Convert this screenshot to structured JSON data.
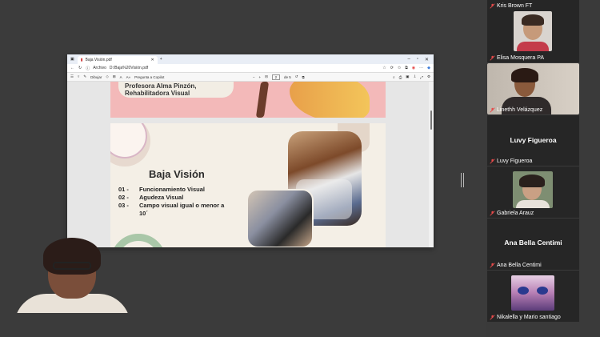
{
  "browser": {
    "tab_title": "Baja Visión.pdf",
    "address_prefix": "Archivo",
    "address": "D:/Baja%20Visión.pdf",
    "pdf_toolbar": {
      "draw_label": "Dibujar",
      "read_aloud_label": "Pregunta a Copilot",
      "page_current": "2",
      "page_total": "de 5"
    }
  },
  "slide_top": {
    "line1": "Profesora Alma Pinzón,",
    "line2": "Rehabilitadora Visual"
  },
  "slide": {
    "title": "Baja Visión",
    "items": [
      {
        "num": "01 -",
        "text": "Funcionamiento Visual"
      },
      {
        "num": "02 -",
        "text": "Agudeza Visual"
      },
      {
        "num": "03 -",
        "text": "Campo visual igual o menor a"
      },
      {
        "num": "",
        "text": "10´"
      }
    ]
  },
  "participants": [
    {
      "name": "Kris Brown FT"
    },
    {
      "name": "Elisa Mosquera PA"
    },
    {
      "name": "Linethh Velázquez"
    },
    {
      "name": "Luvy Figueroa",
      "big": "Luvy Figueroa"
    },
    {
      "name": "Gabriela Arauz"
    },
    {
      "name": "Ana Bella Centimi",
      "big": "Ana Bella Centimi"
    },
    {
      "name": "Nikalella y Mario santiago"
    }
  ],
  "colors": {
    "accent_red": "#e64a4a",
    "panel_bg": "#262626"
  }
}
